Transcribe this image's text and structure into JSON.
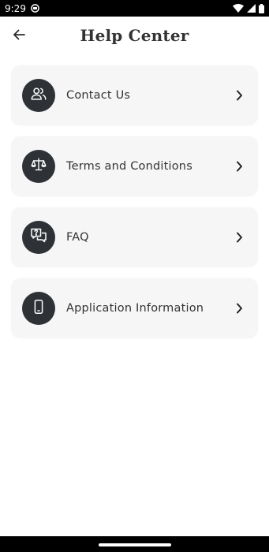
{
  "status_bar": {
    "time": "9:29"
  },
  "header": {
    "title": "Help Center",
    "back_icon": "arrow-left-icon"
  },
  "menu_items": [
    {
      "label": "Contact Us",
      "icon": "users-icon"
    },
    {
      "label": "Terms and Conditions",
      "icon": "scale-icon"
    },
    {
      "label": "FAQ",
      "icon": "faq-chat-icon"
    },
    {
      "label": "Application Information",
      "icon": "smartphone-icon"
    }
  ],
  "colors": {
    "card_background": "#f6f6f6",
    "icon_circle": "#2e3236",
    "text": "#333333",
    "status_bar": "#000000"
  }
}
